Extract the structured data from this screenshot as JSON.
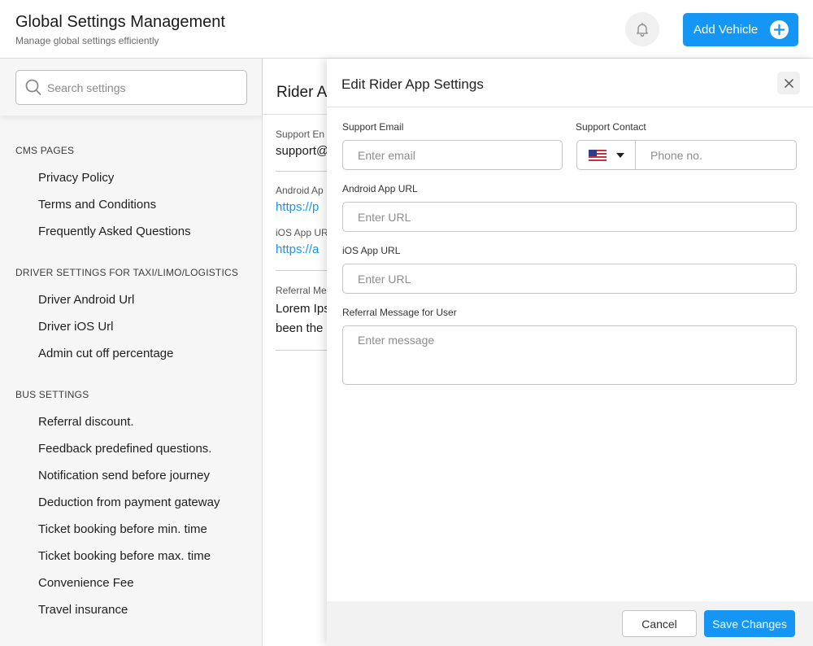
{
  "header": {
    "title": "Global Settings Management",
    "subtitle": "Manage global settings efficiently",
    "bell_icon": "bell-icon",
    "add_button_label": "Add Vehicle",
    "accent": "#1596f5"
  },
  "sidebar": {
    "search_placeholder": "Search settings",
    "sections": [
      {
        "title": "CMS PAGES",
        "items": [
          "Privacy Policy",
          "Terms and Conditions",
          "Frequently Asked Questions"
        ]
      },
      {
        "title": "DRIVER SETTINGS FOR TAXI/LIMO/LOGISTICS",
        "items": [
          "Driver Android Url",
          "Driver iOS Url",
          "Admin cut off percentage"
        ]
      },
      {
        "title": "BUS SETTINGS",
        "items": [
          "Referral discount.",
          "Feedback predefined questions.",
          "Notification send before journey",
          "Deduction from payment gateway",
          "Ticket booking before min. time",
          "Ticket booking before max. time",
          "Convenience Fee",
          "Travel insurance"
        ]
      }
    ]
  },
  "main": {
    "title": "Rider A",
    "support_email_label": "Support En",
    "support_email_value": "support@",
    "android_label": "Android Ap",
    "android_value": "https://p",
    "ios_label": "iOS App UR",
    "ios_value": "https://a",
    "referral_label": "Referral Me",
    "referral_line1": "Lorem Ips",
    "referral_line2": "been the"
  },
  "panel": {
    "title": "Edit Rider App Settings",
    "close_icon": "close-icon",
    "support_email_label": "Support Email",
    "support_email_placeholder": "Enter email",
    "support_contact_label": "Support Contact",
    "country_flag": "us-flag-icon",
    "phone_placeholder": "Phone no.",
    "android_label": "Android App URL",
    "android_placeholder": "Enter URL",
    "ios_label": "iOS App URL",
    "ios_placeholder": "Enter URL",
    "referral_label": "Referral Message for User",
    "referral_placeholder": "Enter message",
    "cancel_label": "Cancel",
    "save_label": "Save Changes"
  }
}
